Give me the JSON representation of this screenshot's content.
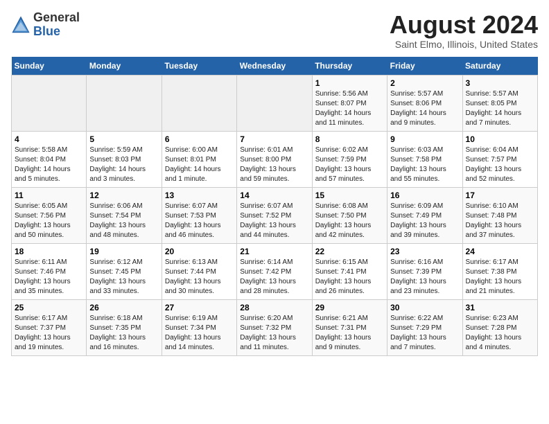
{
  "header": {
    "logo_general": "General",
    "logo_blue": "Blue",
    "month_year": "August 2024",
    "location": "Saint Elmo, Illinois, United States"
  },
  "days_of_week": [
    "Sunday",
    "Monday",
    "Tuesday",
    "Wednesday",
    "Thursday",
    "Friday",
    "Saturday"
  ],
  "weeks": [
    [
      {
        "day": "",
        "info": ""
      },
      {
        "day": "",
        "info": ""
      },
      {
        "day": "",
        "info": ""
      },
      {
        "day": "",
        "info": ""
      },
      {
        "day": "1",
        "info": "Sunrise: 5:56 AM\nSunset: 8:07 PM\nDaylight: 14 hours\nand 11 minutes."
      },
      {
        "day": "2",
        "info": "Sunrise: 5:57 AM\nSunset: 8:06 PM\nDaylight: 14 hours\nand 9 minutes."
      },
      {
        "day": "3",
        "info": "Sunrise: 5:57 AM\nSunset: 8:05 PM\nDaylight: 14 hours\nand 7 minutes."
      }
    ],
    [
      {
        "day": "4",
        "info": "Sunrise: 5:58 AM\nSunset: 8:04 PM\nDaylight: 14 hours\nand 5 minutes."
      },
      {
        "day": "5",
        "info": "Sunrise: 5:59 AM\nSunset: 8:03 PM\nDaylight: 14 hours\nand 3 minutes."
      },
      {
        "day": "6",
        "info": "Sunrise: 6:00 AM\nSunset: 8:01 PM\nDaylight: 14 hours\nand 1 minute."
      },
      {
        "day": "7",
        "info": "Sunrise: 6:01 AM\nSunset: 8:00 PM\nDaylight: 13 hours\nand 59 minutes."
      },
      {
        "day": "8",
        "info": "Sunrise: 6:02 AM\nSunset: 7:59 PM\nDaylight: 13 hours\nand 57 minutes."
      },
      {
        "day": "9",
        "info": "Sunrise: 6:03 AM\nSunset: 7:58 PM\nDaylight: 13 hours\nand 55 minutes."
      },
      {
        "day": "10",
        "info": "Sunrise: 6:04 AM\nSunset: 7:57 PM\nDaylight: 13 hours\nand 52 minutes."
      }
    ],
    [
      {
        "day": "11",
        "info": "Sunrise: 6:05 AM\nSunset: 7:56 PM\nDaylight: 13 hours\nand 50 minutes."
      },
      {
        "day": "12",
        "info": "Sunrise: 6:06 AM\nSunset: 7:54 PM\nDaylight: 13 hours\nand 48 minutes."
      },
      {
        "day": "13",
        "info": "Sunrise: 6:07 AM\nSunset: 7:53 PM\nDaylight: 13 hours\nand 46 minutes."
      },
      {
        "day": "14",
        "info": "Sunrise: 6:07 AM\nSunset: 7:52 PM\nDaylight: 13 hours\nand 44 minutes."
      },
      {
        "day": "15",
        "info": "Sunrise: 6:08 AM\nSunset: 7:50 PM\nDaylight: 13 hours\nand 42 minutes."
      },
      {
        "day": "16",
        "info": "Sunrise: 6:09 AM\nSunset: 7:49 PM\nDaylight: 13 hours\nand 39 minutes."
      },
      {
        "day": "17",
        "info": "Sunrise: 6:10 AM\nSunset: 7:48 PM\nDaylight: 13 hours\nand 37 minutes."
      }
    ],
    [
      {
        "day": "18",
        "info": "Sunrise: 6:11 AM\nSunset: 7:46 PM\nDaylight: 13 hours\nand 35 minutes."
      },
      {
        "day": "19",
        "info": "Sunrise: 6:12 AM\nSunset: 7:45 PM\nDaylight: 13 hours\nand 33 minutes."
      },
      {
        "day": "20",
        "info": "Sunrise: 6:13 AM\nSunset: 7:44 PM\nDaylight: 13 hours\nand 30 minutes."
      },
      {
        "day": "21",
        "info": "Sunrise: 6:14 AM\nSunset: 7:42 PM\nDaylight: 13 hours\nand 28 minutes."
      },
      {
        "day": "22",
        "info": "Sunrise: 6:15 AM\nSunset: 7:41 PM\nDaylight: 13 hours\nand 26 minutes."
      },
      {
        "day": "23",
        "info": "Sunrise: 6:16 AM\nSunset: 7:39 PM\nDaylight: 13 hours\nand 23 minutes."
      },
      {
        "day": "24",
        "info": "Sunrise: 6:17 AM\nSunset: 7:38 PM\nDaylight: 13 hours\nand 21 minutes."
      }
    ],
    [
      {
        "day": "25",
        "info": "Sunrise: 6:17 AM\nSunset: 7:37 PM\nDaylight: 13 hours\nand 19 minutes."
      },
      {
        "day": "26",
        "info": "Sunrise: 6:18 AM\nSunset: 7:35 PM\nDaylight: 13 hours\nand 16 minutes."
      },
      {
        "day": "27",
        "info": "Sunrise: 6:19 AM\nSunset: 7:34 PM\nDaylight: 13 hours\nand 14 minutes."
      },
      {
        "day": "28",
        "info": "Sunrise: 6:20 AM\nSunset: 7:32 PM\nDaylight: 13 hours\nand 11 minutes."
      },
      {
        "day": "29",
        "info": "Sunrise: 6:21 AM\nSunset: 7:31 PM\nDaylight: 13 hours\nand 9 minutes."
      },
      {
        "day": "30",
        "info": "Sunrise: 6:22 AM\nSunset: 7:29 PM\nDaylight: 13 hours\nand 7 minutes."
      },
      {
        "day": "31",
        "info": "Sunrise: 6:23 AM\nSunset: 7:28 PM\nDaylight: 13 hours\nand 4 minutes."
      }
    ]
  ]
}
